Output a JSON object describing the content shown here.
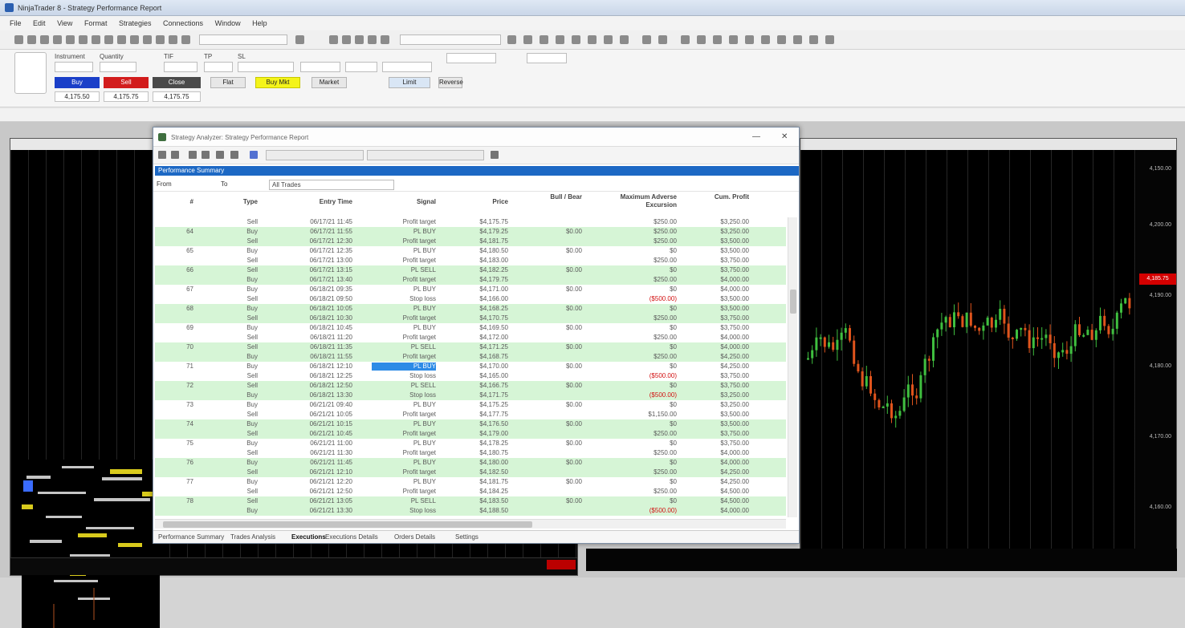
{
  "app": {
    "title": "NinjaTrader 8 - Strategy Performance Report"
  },
  "menu": [
    "File",
    "Edit",
    "View",
    "Format",
    "Strategies",
    "Connections",
    "Window",
    "Help"
  ],
  "order_panel": {
    "instrument_label": "Instrument",
    "quantity_label": "Quantity",
    "tif_label": "TIF",
    "tp_label": "TP",
    "sl_label": "SL",
    "buy_label": "Buy",
    "sell_label": "Sell",
    "close_label": "Close",
    "buy_mkt_label": "Buy Mkt",
    "flat_label": "Flat",
    "market_label": "Market",
    "limit_label": "Limit",
    "reverse_label": "Reverse",
    "bid_price": "4,175.50",
    "ask_price": "4,175.75",
    "last_price": "4,175.75"
  },
  "report": {
    "title": "Strategy Analyzer: Strategy Performance Report",
    "section_title": "Performance Summary",
    "filter_from": "From",
    "filter_to": "To",
    "filter_select": "All Trades",
    "win_controls": {
      "minimize": "—",
      "close": "✕"
    },
    "columns": [
      "#",
      "Type",
      "Entry Time",
      "Signal",
      "Price",
      "Bull / Bear",
      "Maximum Adverse Excursion",
      "Cum. Profit"
    ],
    "trades": [
      {
        "n": "",
        "type": "Sell",
        "time": "06/17/21 11:45",
        "signal": "Profit target",
        "price": "$4,175.75",
        "bull": "",
        "mae": "$250.00",
        "cum": "$3,250.00",
        "green": false
      },
      {
        "n": "64",
        "type": "Buy",
        "time": "06/17/21 11:55",
        "signal": "PL BUY",
        "price": "$4,179.25",
        "bull": "$0.00",
        "mae": "$250.00",
        "cum": "$3,250.00",
        "green": true
      },
      {
        "n": "",
        "type": "Sell",
        "time": "06/17/21 12:30",
        "signal": "Profit target",
        "price": "$4,181.75",
        "bull": "",
        "mae": "$250.00",
        "cum": "$3,500.00",
        "green": true
      },
      {
        "n": "65",
        "type": "Buy",
        "time": "06/17/21 12:35",
        "signal": "PL BUY",
        "price": "$4,180.50",
        "bull": "$0.00",
        "mae": "$0",
        "cum": "$3,500.00",
        "green": false
      },
      {
        "n": "",
        "type": "Sell",
        "time": "06/17/21 13:00",
        "signal": "Profit target",
        "price": "$4,183.00",
        "bull": "",
        "mae": "$250.00",
        "cum": "$3,750.00",
        "green": false
      },
      {
        "n": "66",
        "type": "Sell",
        "time": "06/17/21 13:15",
        "signal": "PL SELL",
        "price": "$4,182.25",
        "bull": "$0.00",
        "mae": "$0",
        "cum": "$3,750.00",
        "green": true
      },
      {
        "n": "",
        "type": "Buy",
        "time": "06/17/21 13:40",
        "signal": "Profit target",
        "price": "$4,179.75",
        "bull": "",
        "mae": "$250.00",
        "cum": "$4,000.00",
        "green": true
      },
      {
        "n": "67",
        "type": "Buy",
        "time": "06/18/21 09:35",
        "signal": "PL BUY",
        "price": "$4,171.00",
        "bull": "$0.00",
        "mae": "$0",
        "cum": "$4,000.00",
        "green": false
      },
      {
        "n": "",
        "type": "Sell",
        "time": "06/18/21 09:50",
        "signal": "Stop loss",
        "price": "$4,166.00",
        "bull": "",
        "mae": "($500.00)",
        "cum": "$3,500.00",
        "green": false,
        "red": true
      },
      {
        "n": "68",
        "type": "Buy",
        "time": "06/18/21 10:05",
        "signal": "PL BUY",
        "price": "$4,168.25",
        "bull": "$0.00",
        "mae": "$0",
        "cum": "$3,500.00",
        "green": true
      },
      {
        "n": "",
        "type": "Sell",
        "time": "06/18/21 10:30",
        "signal": "Profit target",
        "price": "$4,170.75",
        "bull": "",
        "mae": "$250.00",
        "cum": "$3,750.00",
        "green": true
      },
      {
        "n": "69",
        "type": "Buy",
        "time": "06/18/21 10:45",
        "signal": "PL BUY",
        "price": "$4,169.50",
        "bull": "$0.00",
        "mae": "$0",
        "cum": "$3,750.00",
        "green": false
      },
      {
        "n": "",
        "type": "Sell",
        "time": "06/18/21 11:20",
        "signal": "Profit target",
        "price": "$4,172.00",
        "bull": "",
        "mae": "$250.00",
        "cum": "$4,000.00",
        "green": false
      },
      {
        "n": "70",
        "type": "Sell",
        "time": "06/18/21 11:35",
        "signal": "PL SELL",
        "price": "$4,171.25",
        "bull": "$0.00",
        "mae": "$0",
        "cum": "$4,000.00",
        "green": true
      },
      {
        "n": "",
        "type": "Buy",
        "time": "06/18/21 11:55",
        "signal": "Profit target",
        "price": "$4,168.75",
        "bull": "",
        "mae": "$250.00",
        "cum": "$4,250.00",
        "green": true
      },
      {
        "n": "71",
        "type": "Buy",
        "time": "06/18/21 12:10",
        "signal": "PL BUY",
        "price": "$4,170.00",
        "bull": "$0.00",
        "mae": "$0",
        "cum": "$4,250.00",
        "green": false,
        "highlight": true
      },
      {
        "n": "",
        "type": "Sell",
        "time": "06/18/21 12:25",
        "signal": "Stop loss",
        "price": "$4,165.00",
        "bull": "",
        "mae": "($500.00)",
        "cum": "$3,750.00",
        "green": false,
        "red": true
      },
      {
        "n": "72",
        "type": "Sell",
        "time": "06/18/21 12:50",
        "signal": "PL SELL",
        "price": "$4,166.75",
        "bull": "$0.00",
        "mae": "$0",
        "cum": "$3,750.00",
        "green": true
      },
      {
        "n": "",
        "type": "Buy",
        "time": "06/18/21 13:30",
        "signal": "Stop loss",
        "price": "$4,171.75",
        "bull": "",
        "mae": "($500.00)",
        "cum": "$3,250.00",
        "green": true,
        "red": true
      },
      {
        "n": "73",
        "type": "Buy",
        "time": "06/21/21 09:40",
        "signal": "PL BUY",
        "price": "$4,175.25",
        "bull": "$0.00",
        "mae": "$0",
        "cum": "$3,250.00",
        "green": false
      },
      {
        "n": "",
        "type": "Sell",
        "time": "06/21/21 10:05",
        "signal": "Profit target",
        "price": "$4,177.75",
        "bull": "",
        "mae": "$1,150.00",
        "cum": "$3,500.00",
        "green": false
      },
      {
        "n": "74",
        "type": "Buy",
        "time": "06/21/21 10:15",
        "signal": "PL BUY",
        "price": "$4,176.50",
        "bull": "$0.00",
        "mae": "$0",
        "cum": "$3,500.00",
        "green": true
      },
      {
        "n": "",
        "type": "Sell",
        "time": "06/21/21 10:45",
        "signal": "Profit target",
        "price": "$4,179.00",
        "bull": "",
        "mae": "$250.00",
        "cum": "$3,750.00",
        "green": true
      },
      {
        "n": "75",
        "type": "Buy",
        "time": "06/21/21 11:00",
        "signal": "PL BUY",
        "price": "$4,178.25",
        "bull": "$0.00",
        "mae": "$0",
        "cum": "$3,750.00",
        "green": false
      },
      {
        "n": "",
        "type": "Sell",
        "time": "06/21/21 11:30",
        "signal": "Profit target",
        "price": "$4,180.75",
        "bull": "",
        "mae": "$250.00",
        "cum": "$4,000.00",
        "green": false
      },
      {
        "n": "76",
        "type": "Buy",
        "time": "06/21/21 11:45",
        "signal": "PL BUY",
        "price": "$4,180.00",
        "bull": "$0.00",
        "mae": "$0",
        "cum": "$4,000.00",
        "green": true
      },
      {
        "n": "",
        "type": "Sell",
        "time": "06/21/21 12:10",
        "signal": "Profit target",
        "price": "$4,182.50",
        "bull": "",
        "mae": "$250.00",
        "cum": "$4,250.00",
        "green": true
      },
      {
        "n": "77",
        "type": "Buy",
        "time": "06/21/21 12:20",
        "signal": "PL BUY",
        "price": "$4,181.75",
        "bull": "$0.00",
        "mae": "$0",
        "cum": "$4,250.00",
        "green": false
      },
      {
        "n": "",
        "type": "Sell",
        "time": "06/21/21 12:50",
        "signal": "Profit target",
        "price": "$4,184.25",
        "bull": "",
        "mae": "$250.00",
        "cum": "$4,500.00",
        "green": false
      },
      {
        "n": "78",
        "type": "Sell",
        "time": "06/21/21 13:05",
        "signal": "PL SELL",
        "price": "$4,183.50",
        "bull": "$0.00",
        "mae": "$0",
        "cum": "$4,500.00",
        "green": true
      },
      {
        "n": "",
        "type": "Buy",
        "time": "06/21/21 13:30",
        "signal": "Stop loss",
        "price": "$4,188.50",
        "bull": "",
        "mae": "($500.00)",
        "cum": "$4,000.00",
        "green": true,
        "red": true
      }
    ],
    "tabs": [
      "Performance Summary",
      "Trades Analysis",
      "Executions",
      "Executions Details",
      "Orders Details",
      "Settings"
    ]
  },
  "right_chart": {
    "y_labels": [
      "4,200.00",
      "4,190.00",
      "4,180.00",
      "4,170.00",
      "4,160.00",
      "4,150.00"
    ],
    "price_tag": "4,185.75"
  },
  "colors": {
    "accent": "#1c68c4",
    "buy": "#1a3fc8",
    "sell": "#d21c1c",
    "row_green": "#d6f5d6"
  }
}
